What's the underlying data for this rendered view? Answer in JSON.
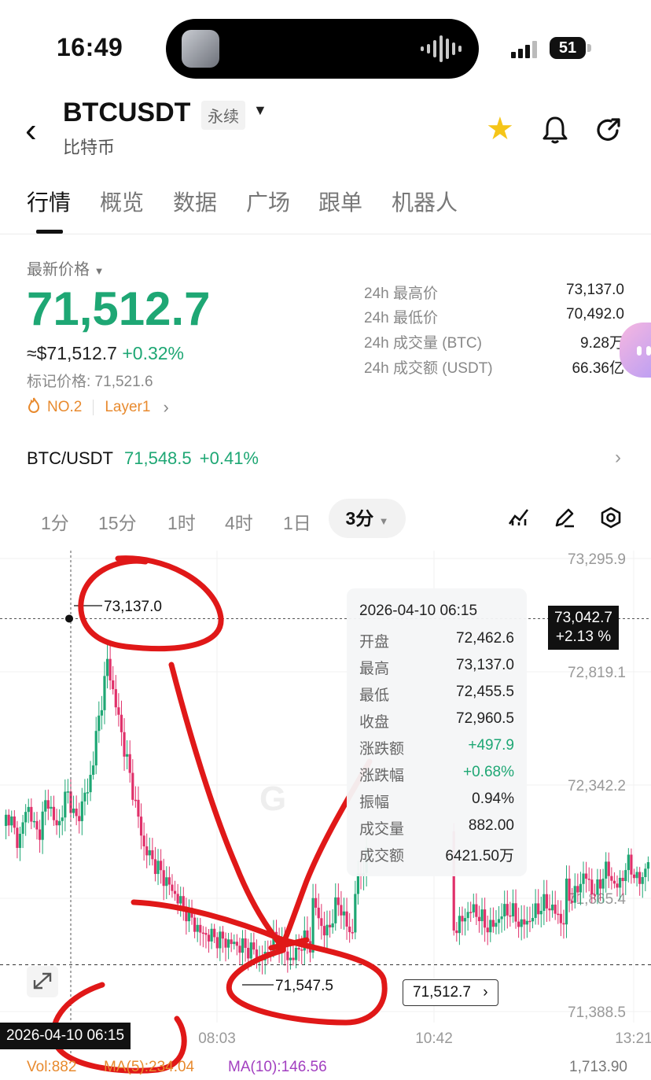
{
  "status_bar": {
    "time": "16:49",
    "battery": "51"
  },
  "header": {
    "back_icon": "chevron-left-icon",
    "symbol": "BTCUSDT",
    "contract_type": "永续",
    "subtitle": "比特币",
    "icons": [
      "star-icon",
      "bell-icon",
      "share-icon"
    ],
    "star_color": "#f5c518"
  },
  "tabs": [
    {
      "label": "行情",
      "active": true
    },
    {
      "label": "概览"
    },
    {
      "label": "数据"
    },
    {
      "label": "广场"
    },
    {
      "label": "跟单"
    },
    {
      "label": "机器人"
    }
  ],
  "price": {
    "label": "最新价格",
    "last": "71,512.7",
    "usd_equiv": "≈$71,512.7",
    "change_pct": "+0.32%",
    "mark_price": "标记价格: 71,521.6",
    "rank_tag": "NO.2",
    "category_tag": "Layer1",
    "up_color": "#1ea774"
  },
  "stats": [
    {
      "label": "24h 最高价",
      "value": "73,137.0"
    },
    {
      "label": "24h 最低价",
      "value": "70,492.0"
    },
    {
      "label": "24h 成交量 (BTC)",
      "value": "9.28万"
    },
    {
      "label": "24h 成交额 (USDT)",
      "value": "66.36亿"
    }
  ],
  "spot_pair": {
    "name": "BTC/USDT",
    "price": "71,548.5",
    "change": "+0.41%"
  },
  "intervals": {
    "items": [
      "1分",
      "15分",
      "1时",
      "4时",
      "1日"
    ],
    "selected": "3分"
  },
  "chart_tools": [
    "indicator-icon",
    "draw-pen-icon",
    "settings-icon"
  ],
  "chart_data": {
    "type": "candlestick",
    "y_axis_ticks": [
      "73,295.9",
      "72,819.1",
      "72,342.2",
      "71,865.4",
      "71,388.5"
    ],
    "x_axis_ticks": [
      "08:03",
      "10:42",
      "13:21"
    ],
    "y_range": [
      71388.5,
      73295.9
    ],
    "high_marker": "73,137.0",
    "low_marker": "71,547.5",
    "last_price_tag": "71,512.7",
    "crosshair": {
      "time": "2026-04-10 06:15",
      "price": "73,042.7",
      "pct": "+2.13 %"
    },
    "tooltip": {
      "datetime": "2026-04-10 06:15",
      "rows": [
        {
          "k": "开盘",
          "v": "72,462.6"
        },
        {
          "k": "最高",
          "v": "73,137.0"
        },
        {
          "k": "最低",
          "v": "72,455.5"
        },
        {
          "k": "收盘",
          "v": "72,960.5"
        },
        {
          "k": "涨跌额",
          "v": "+497.9",
          "green": true
        },
        {
          "k": "涨跌幅",
          "v": "+0.68%",
          "green": true
        },
        {
          "k": "振幅",
          "v": "0.94%"
        },
        {
          "k": "成交量",
          "v": "882.00"
        },
        {
          "k": "成交额",
          "v": "6421.50万"
        }
      ]
    },
    "volume_row": {
      "vol_label": "Vol:882",
      "ma5": "MA(5):234.04",
      "ma10": "MA(10):146.56",
      "axis_max": "1,713.90"
    },
    "up_color": "#1ea774",
    "down_color": "#e0306a"
  }
}
